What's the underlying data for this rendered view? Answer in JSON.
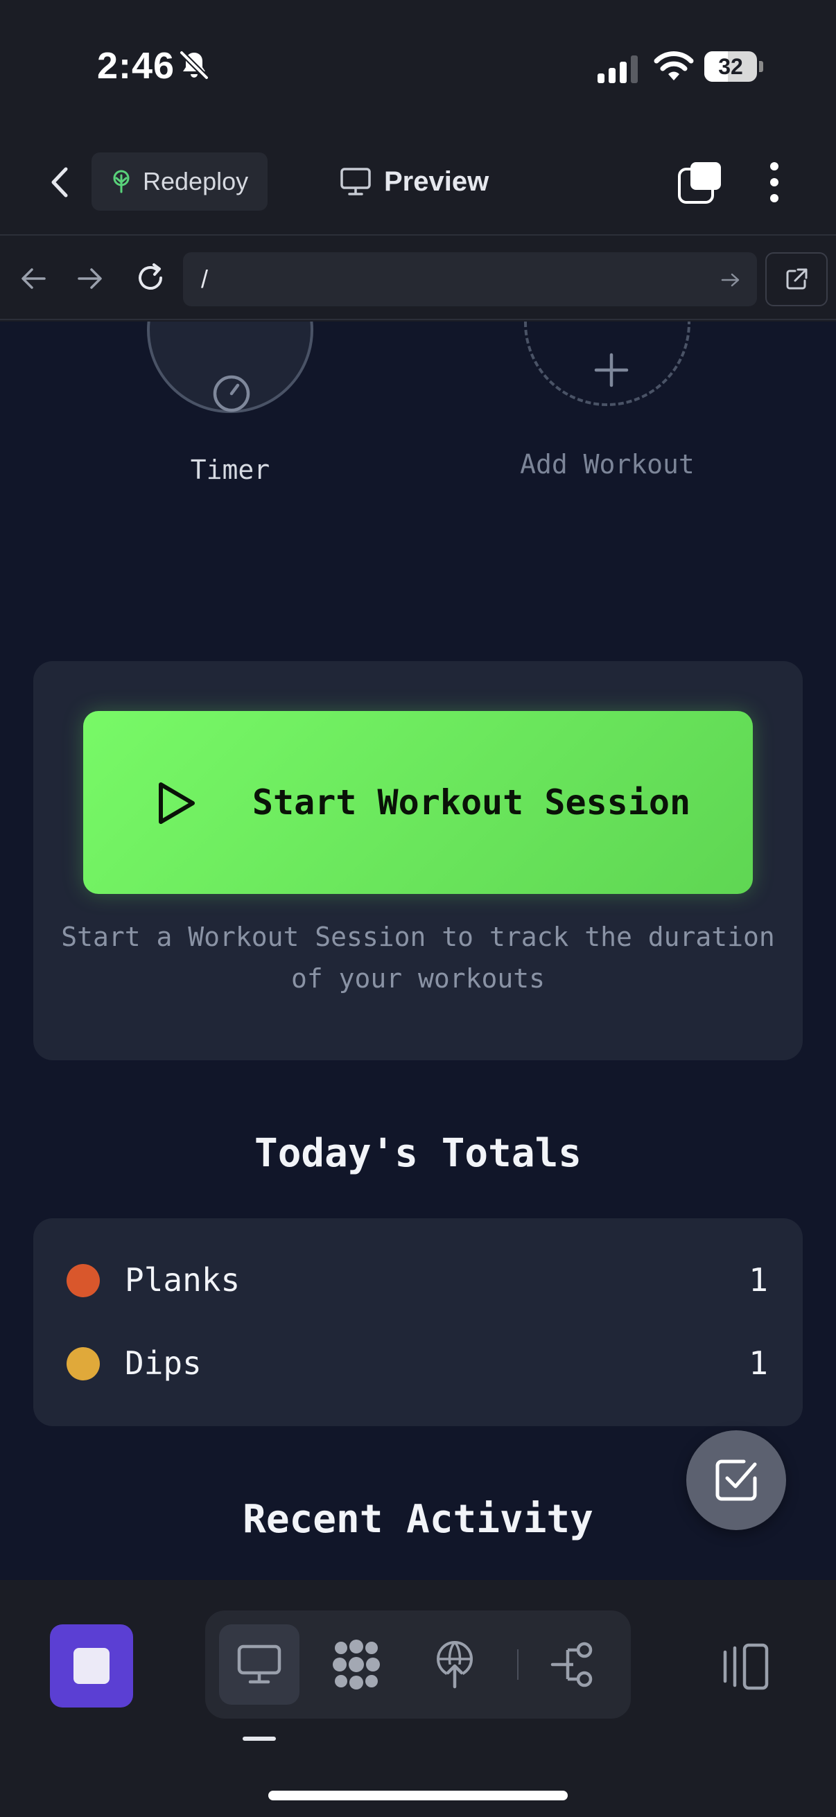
{
  "status_bar": {
    "time": "2:46",
    "battery_percent": "32"
  },
  "header": {
    "redeploy_label": "Redeploy",
    "preview_label": "Preview"
  },
  "browser": {
    "url": "/"
  },
  "quick_actions": {
    "timer_label": "Timer",
    "add_workout_label": "Add Workout"
  },
  "session": {
    "start_label": "Start Workout Session",
    "description": "Start a Workout Session to track the duration of your workouts"
  },
  "totals": {
    "title": "Today's Totals",
    "items": [
      {
        "name": "Planks",
        "count": "1",
        "color": "#d9572c"
      },
      {
        "name": "Dips",
        "count": "1",
        "color": "#e0a93a"
      }
    ]
  },
  "recent_activity": {
    "title": "Recent Activity"
  },
  "colors": {
    "accent_green": "#6ee85c",
    "stop_purple": "#5b3fd3",
    "card_bg": "#202637",
    "content_bg": "#111629"
  },
  "icons": {
    "status": [
      "bell-slash-icon",
      "signal-icon",
      "wifi-icon",
      "battery-icon"
    ],
    "header": [
      "chevron-left-icon",
      "tree-icon",
      "monitor-icon",
      "windows-icon",
      "more-vertical-icon"
    ],
    "browser": [
      "arrow-left-icon",
      "arrow-right-icon",
      "reload-icon",
      "arrow-right-icon",
      "external-link-icon"
    ],
    "content": [
      "stopwatch-icon",
      "plus-icon",
      "play-icon",
      "checkbox-icon"
    ],
    "toolbar": [
      "stop-icon",
      "monitor-icon",
      "dots-grid-icon",
      "deploy-icon",
      "git-branch-icon",
      "panels-icon"
    ]
  }
}
